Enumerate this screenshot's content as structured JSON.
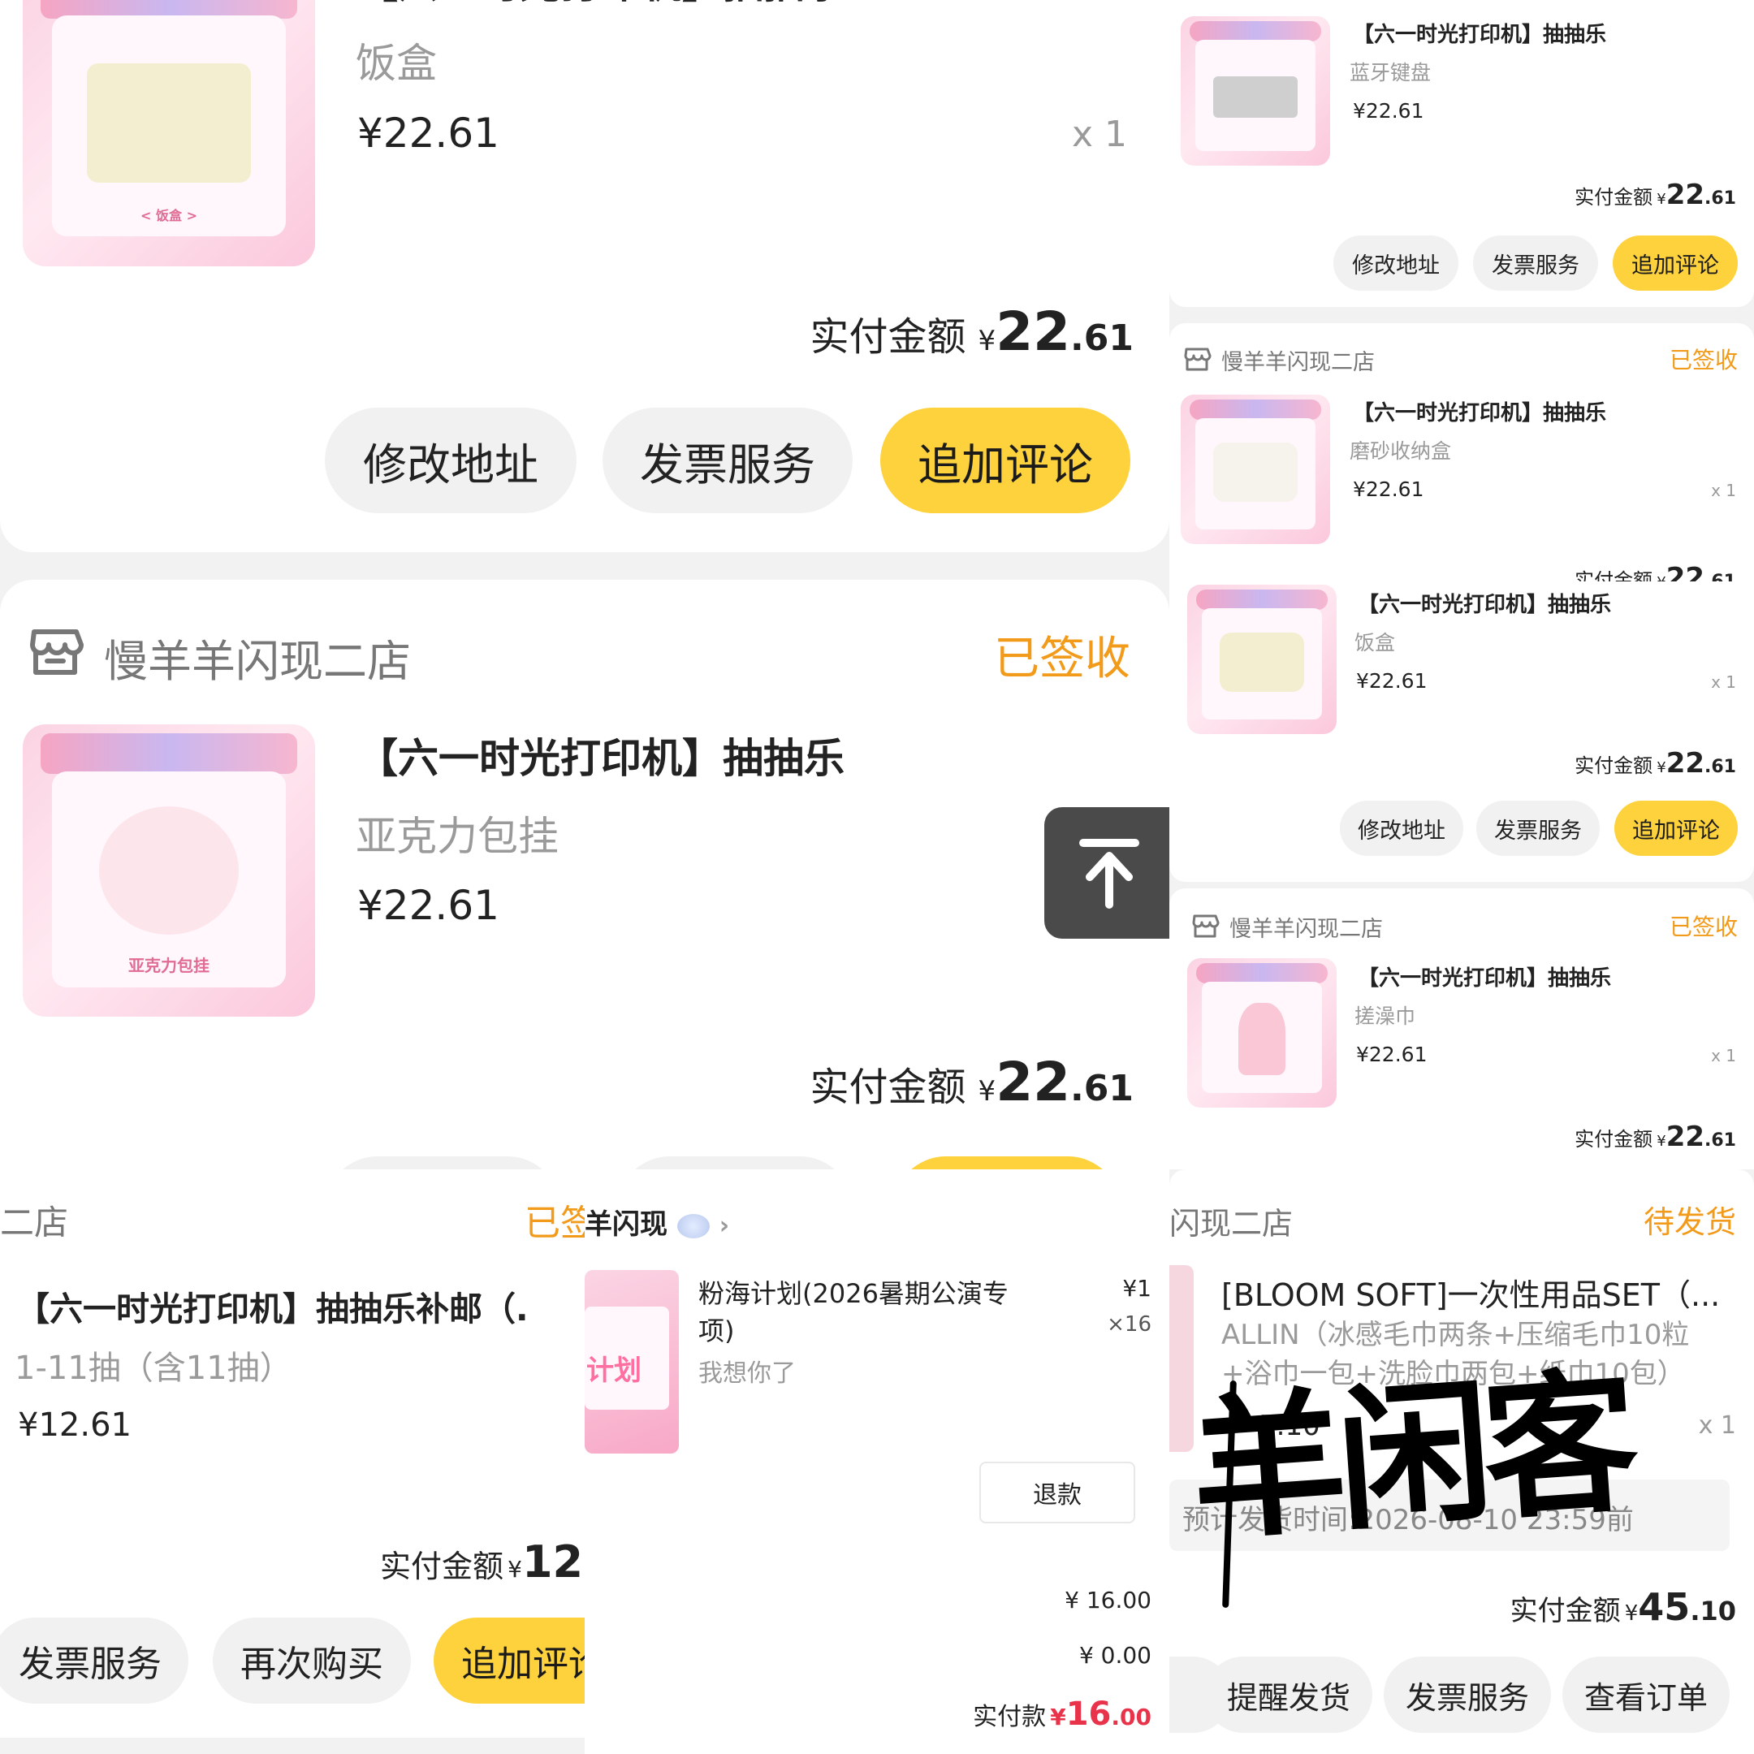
{
  "buttons": {
    "modify_address": "修改地址",
    "invoice": "发票服务",
    "add_review": "追加评论",
    "buy_again": "再次购买",
    "remind_ship": "提醒发货",
    "view_order": "查看订单",
    "refund": "退款"
  },
  "labels": {
    "paid_amount": "实付金额",
    "currency": "¥",
    "paid": "实付款",
    "qty": "x 1"
  },
  "left_top": {
    "title": "【六一时光打印机】抽抽乐",
    "variant": "饭盒",
    "price": "¥22.61",
    "qty": "x 1",
    "total_int": "22",
    "total_dec": ".61",
    "thumb_caption": "< 饭盒 >"
  },
  "left_mid": {
    "shop": "慢羊羊闪现二店",
    "status": "已签收",
    "title": "【六一时光打印机】抽抽乐",
    "variant": "亚克力包挂",
    "price": "¥22.61",
    "qty": "x 1",
    "total_int": "22",
    "total_dec": ".61",
    "thumb_caption": "亚克力包挂"
  },
  "right_top": {
    "title": "【六一时光打印机】抽抽乐",
    "variant": "蓝牙键盘",
    "price": "¥22.61",
    "total_int": "22",
    "total_dec": ".61"
  },
  "right_order2": {
    "shop": "慢羊羊闪现二店",
    "status": "已签收",
    "item1": {
      "title": "【六一时光打印机】抽抽乐",
      "variant": "磨砂收纳盒",
      "price": "¥22.61",
      "qty": "x 1"
    },
    "total1_int": "22",
    "total1_dec": ".61",
    "item2": {
      "title": "【六一时光打印机】抽抽乐",
      "variant": "饭盒",
      "price": "¥22.61",
      "qty": "x 1"
    },
    "total2_int": "22",
    "total2_dec": ".61"
  },
  "right_order3": {
    "shop": "慢羊羊闪现二店",
    "status": "已签收",
    "title": "【六一时光打印机】抽抽乐",
    "variant": "搓澡巾",
    "price": "¥22.61",
    "qty": "x 1",
    "total_int": "22",
    "total_dec": ".61"
  },
  "bottom_left": {
    "shop_fragment": "二店",
    "status_fragment": "已签",
    "title": "【六一时光打印机】抽抽乐补邮（.",
    "variant": "1-11抽（含11抽）",
    "price": "¥12.61",
    "total_fragment": "12"
  },
  "bottom_mid": {
    "shop_fragment": "羊闪现",
    "title": "粉海计划(2026暑期公演专项)",
    "subtitle": "我想你了",
    "unit_price": "¥1",
    "count": "×16",
    "subtotal": "¥ 16.00",
    "discount": "¥ 0.00",
    "paid_int": "16",
    "paid_dec": ".00",
    "thumb_text": "计划"
  },
  "bottom_right": {
    "shop_fragment": "闪现二店",
    "status": "待发货",
    "title": "[BLOOM SOFT]一次性用品SET（...",
    "variant": "ALLIN（冰感毛巾两条+压缩毛巾10粒+浴巾一包+洗脸巾两包+纸巾10包）",
    "price_fragment": "5.10",
    "qty": "x 1",
    "ship_time": "预计发货时间:2026-08-10 23:59前",
    "total_int": "45",
    "total_dec": ".10"
  },
  "watermark": "羊闲客",
  "colors": {
    "accent_yellow": "#fed23c",
    "status_orange": "#f29a1a",
    "price_red": "#e8334a",
    "muted_gray": "#9a9a9a"
  }
}
